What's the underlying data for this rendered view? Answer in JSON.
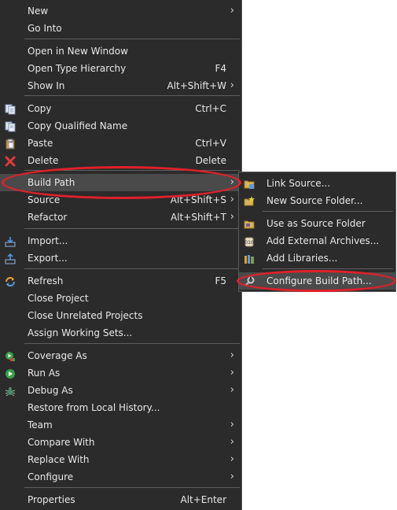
{
  "main_menu": {
    "items": [
      {
        "label": "New",
        "accel": "",
        "submenu": true
      },
      {
        "label": "Go Into",
        "accel": "",
        "submenu": false
      },
      {
        "label": "Open in New Window",
        "accel": "",
        "submenu": false
      },
      {
        "label": "Open Type Hierarchy",
        "accel": "F4",
        "submenu": false
      },
      {
        "label": "Show In",
        "accel": "Alt+Shift+W",
        "submenu": true
      },
      {
        "label": "Copy",
        "accel": "Ctrl+C",
        "submenu": false,
        "icon": "copy-icon"
      },
      {
        "label": "Copy Qualified Name",
        "accel": "",
        "submenu": false,
        "icon": "copy-qualified-name-icon"
      },
      {
        "label": "Paste",
        "accel": "Ctrl+V",
        "submenu": false,
        "icon": "paste-icon"
      },
      {
        "label": "Delete",
        "accel": "Delete",
        "submenu": false,
        "icon": "delete-icon"
      },
      {
        "label": "Build Path",
        "accel": "",
        "submenu": true,
        "highlighted": true
      },
      {
        "label": "Source",
        "accel": "Alt+Shift+S",
        "submenu": true
      },
      {
        "label": "Refactor",
        "accel": "Alt+Shift+T",
        "submenu": true
      },
      {
        "label": "Import...",
        "accel": "",
        "submenu": false,
        "icon": "import-icon"
      },
      {
        "label": "Export...",
        "accel": "",
        "submenu": false,
        "icon": "export-icon"
      },
      {
        "label": "Refresh",
        "accel": "F5",
        "submenu": false,
        "icon": "refresh-icon"
      },
      {
        "label": "Close Project",
        "accel": "",
        "submenu": false
      },
      {
        "label": "Close Unrelated Projects",
        "accel": "",
        "submenu": false
      },
      {
        "label": "Assign Working Sets...",
        "accel": "",
        "submenu": false
      },
      {
        "label": "Coverage As",
        "accel": "",
        "submenu": true,
        "icon": "coverage-icon"
      },
      {
        "label": "Run As",
        "accel": "",
        "submenu": true,
        "icon": "run-icon"
      },
      {
        "label": "Debug As",
        "accel": "",
        "submenu": true,
        "icon": "debug-bug-icon"
      },
      {
        "label": "Restore from Local History...",
        "accel": "",
        "submenu": false
      },
      {
        "label": "Team",
        "accel": "",
        "submenu": true
      },
      {
        "label": "Compare With",
        "accel": "",
        "submenu": true
      },
      {
        "label": "Replace With",
        "accel": "",
        "submenu": true
      },
      {
        "label": "Configure",
        "accel": "",
        "submenu": true
      },
      {
        "label": "Properties",
        "accel": "Alt+Enter",
        "submenu": false
      }
    ]
  },
  "build_path_submenu": {
    "items": [
      {
        "label": "Link Source...",
        "icon": "link-source-icon"
      },
      {
        "label": "New Source Folder...",
        "icon": "new-source-folder-icon"
      },
      {
        "label": "Use as Source Folder",
        "icon": "use-as-source-folder-icon"
      },
      {
        "label": "Add External Archives...",
        "icon": "add-external-archives-icon"
      },
      {
        "label": "Add Libraries...",
        "icon": "add-libraries-icon"
      },
      {
        "label": "Configure Build Path...",
        "icon": "configure-build-path-icon",
        "highlighted": true
      }
    ]
  },
  "colors": {
    "menu_bg": "#2b2b2b",
    "highlight_bg": "#4a4a4a",
    "text": "#e8e8e8",
    "separator": "#5e5e5e",
    "annotation_red": "#e0202a"
  },
  "arrow_glyph": "›"
}
